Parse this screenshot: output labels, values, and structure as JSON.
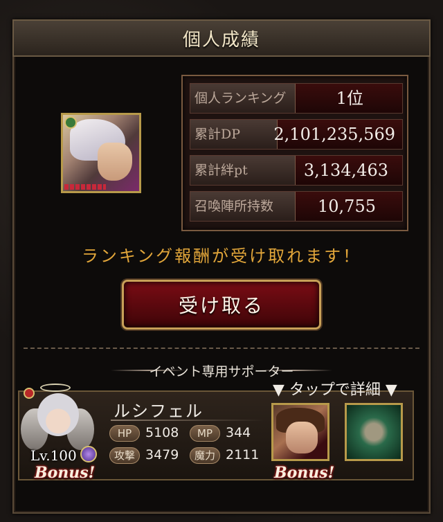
{
  "header": {
    "title": "個人成績"
  },
  "stats": [
    {
      "label": "個人ランキング",
      "value": "1位"
    },
    {
      "label": "累計DP",
      "value": "2,101,235,569"
    },
    {
      "label": "累計絆pt",
      "value": "3,134,463"
    },
    {
      "label": "召喚陣所持数",
      "value": "10,755"
    }
  ],
  "notice": "ランキング報酬が受け取れます！",
  "receive_button": {
    "label": "受け取る"
  },
  "supporter": {
    "section_title": "イベント専用サポーター",
    "tap_hint": "▼ タップで詳細 ▼",
    "character": {
      "name": "ルシフェル",
      "level": "Lv.100",
      "bonus": "Bonus!",
      "hp_label": "HP",
      "hp": "5108",
      "mp_label": "MP",
      "mp": "344",
      "atk_label": "攻撃",
      "atk": "3479",
      "mag_label": "魔力",
      "mag": "2111"
    },
    "card_bonus": "Bonus!"
  },
  "colors": {
    "notice": "#e2a63a",
    "button_bg": "#7a0c14",
    "frame": "#0d0b0a"
  },
  "icons": [
    "element-icon",
    "gem-icon",
    "halo-icon"
  ]
}
